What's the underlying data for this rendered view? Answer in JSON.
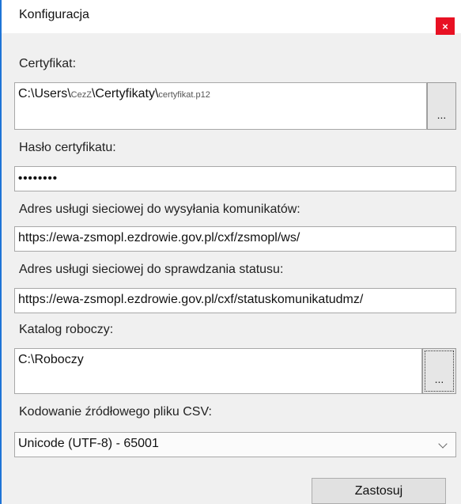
{
  "window": {
    "title": "Konfiguracja",
    "close_label": "×"
  },
  "certificate": {
    "label": "Certyfikat:",
    "path_prefix": "C:\\Users\\",
    "user_segment": "CezZ",
    "path_middle": "\\Certyfikaty\\",
    "file_name": "certyfikat.p12",
    "browse_label": "..."
  },
  "password": {
    "label": "Hasło certyfikatu:",
    "value": "••••••••"
  },
  "send_service": {
    "label": "Adres usługi sieciowej do wysyłania komunikatów:",
    "value": "https://ewa-zsmopl.ezdrowie.gov.pl/cxf/zsmopl/ws/"
  },
  "status_service": {
    "label": "Adres usługi sieciowej do sprawdzania statusu:",
    "value": "https://ewa-zsmopl.ezdrowie.gov.pl/cxf/statuskomunikatudmz/"
  },
  "work_dir": {
    "label": "Katalog roboczy:",
    "value": "C:\\Roboczy",
    "browse_label": "..."
  },
  "encoding": {
    "label": "Kodowanie źródłowego pliku CSV:",
    "selected": "Unicode (UTF-8) - 65001"
  },
  "apply_label": "Zastosuj",
  "colors": {
    "accent": "#1e74d6",
    "close": "#e81123"
  }
}
